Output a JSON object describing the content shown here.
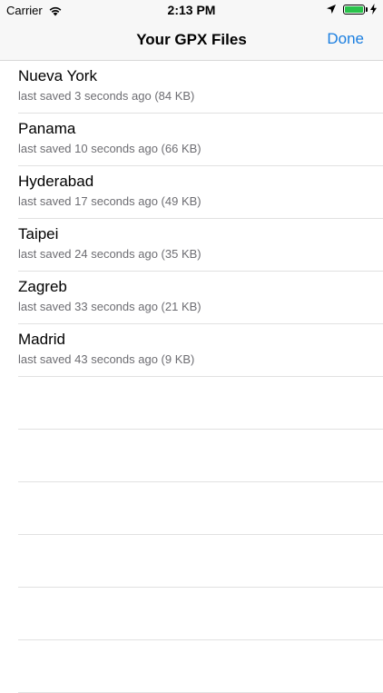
{
  "status_bar": {
    "carrier": "Carrier",
    "time": "2:13 PM",
    "battery_level": 1.0,
    "battery_color": "#29c34b"
  },
  "nav": {
    "title": "Your GPX Files",
    "done_label": "Done",
    "accent_color": "#1a7ee0"
  },
  "files": [
    {
      "name": "Nueva York",
      "meta": "last saved 3 seconds ago (84 KB)"
    },
    {
      "name": "Panama",
      "meta": "last saved 10 seconds ago (66 KB)"
    },
    {
      "name": "Hyderabad",
      "meta": "last saved 17 seconds ago (49 KB)"
    },
    {
      "name": "Taipei",
      "meta": "last saved 24 seconds ago (35 KB)"
    },
    {
      "name": "Zagreb",
      "meta": "last saved 33 seconds ago (21 KB)"
    },
    {
      "name": "Madrid",
      "meta": "last saved 43 seconds ago (9 KB)"
    }
  ]
}
